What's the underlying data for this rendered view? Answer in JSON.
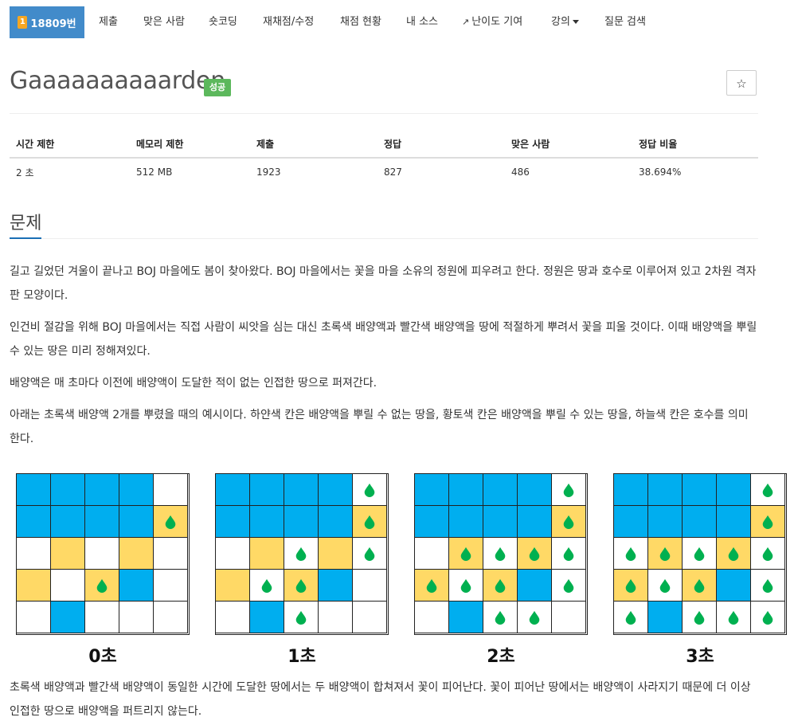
{
  "nav": {
    "problem_id": "18809번",
    "tier_mark": "1",
    "items": [
      "제출",
      "맞은 사람",
      "숏코딩",
      "재채점/수정",
      "채점 현황",
      "내 소스",
      "난이도 기여",
      "강의",
      "질문 검색"
    ]
  },
  "problem": {
    "title": "Gaaaaaaaaaarden",
    "badge": "성공",
    "star": "☆"
  },
  "info_table": {
    "headers": [
      "시간 제한",
      "메모리 제한",
      "제출",
      "정답",
      "맞은 사람",
      "정답 비율"
    ],
    "values": [
      "2 초",
      "512 MB",
      "1923",
      "827",
      "486",
      "38.694%"
    ]
  },
  "section": {
    "title": "문제"
  },
  "paragraphs": [
    "길고 길었던 겨울이 끝나고 BOJ 마을에도 봄이 찾아왔다. BOJ 마을에서는 꽃을 마을 소유의 정원에 피우려고 한다. 정원은 땅과 호수로 이루어져 있고 2차원 격자판 모양이다.",
    "인건비 절감을 위해 BOJ 마을에서는 직접 사람이 씨앗을 심는 대신 초록색 배양액과 빨간색 배양액을 땅에 적절하게 뿌려서 꽃을 피울 것이다. 이때 배양액을 뿌릴 수 있는 땅은 미리 정해져있다.",
    "배양액은 매 초마다 이전에 배양액이 도달한 적이 없는 인접한 땅으로 퍼져간다.",
    "아래는 초록색 배양액 2개를 뿌렸을 때의 예시이다. 하얀색 칸은 배양액을 뿌릴 수 없는 땅을, 황토색 칸은 배양액을 뿌릴 수 있는 땅을, 하늘색 칸은 호수를 의미한다.",
    "초록색 배양액과 빨간색 배양액이 동일한 시간에 도달한 땅에서는 두 배양액이 합쳐져서 꽃이 피어난다. 꽃이 피어난 땅에서는 배양액이 사라지기 때문에 더 이상 인접한 땅으로 배양액을 퍼트리지 않는다."
  ],
  "figures": {
    "colors": {
      "lake": "#00aeef",
      "soil": "#ffd966",
      "land": "#ffffff",
      "drop": "#00b050"
    },
    "grid": [
      [
        "L",
        "L",
        "L",
        "L",
        "W"
      ],
      [
        "L",
        "L",
        "L",
        "L",
        "Y"
      ],
      [
        "W",
        "Y",
        "W",
        "Y",
        "W"
      ],
      [
        "Y",
        "W",
        "Y",
        "L",
        "W"
      ],
      [
        "W",
        "L",
        "W",
        "W",
        "W"
      ]
    ],
    "frames": [
      {
        "label": "0초",
        "drops": [
          [
            1,
            4
          ],
          [
            3,
            2
          ]
        ]
      },
      {
        "label": "1초",
        "drops": [
          [
            0,
            4
          ],
          [
            1,
            4
          ],
          [
            2,
            2
          ],
          [
            2,
            4
          ],
          [
            3,
            1
          ],
          [
            3,
            2
          ],
          [
            4,
            2
          ]
        ]
      },
      {
        "label": "2초",
        "drops": [
          [
            0,
            4
          ],
          [
            1,
            4
          ],
          [
            2,
            1
          ],
          [
            2,
            2
          ],
          [
            2,
            3
          ],
          [
            2,
            4
          ],
          [
            3,
            0
          ],
          [
            3,
            1
          ],
          [
            3,
            2
          ],
          [
            3,
            4
          ],
          [
            4,
            2
          ],
          [
            4,
            3
          ]
        ]
      },
      {
        "label": "3초",
        "drops": [
          [
            0,
            4
          ],
          [
            1,
            4
          ],
          [
            2,
            0
          ],
          [
            2,
            1
          ],
          [
            2,
            2
          ],
          [
            2,
            3
          ],
          [
            2,
            4
          ],
          [
            3,
            0
          ],
          [
            3,
            1
          ],
          [
            3,
            2
          ],
          [
            3,
            4
          ],
          [
            4,
            0
          ],
          [
            4,
            2
          ],
          [
            4,
            3
          ],
          [
            4,
            4
          ]
        ]
      }
    ]
  }
}
